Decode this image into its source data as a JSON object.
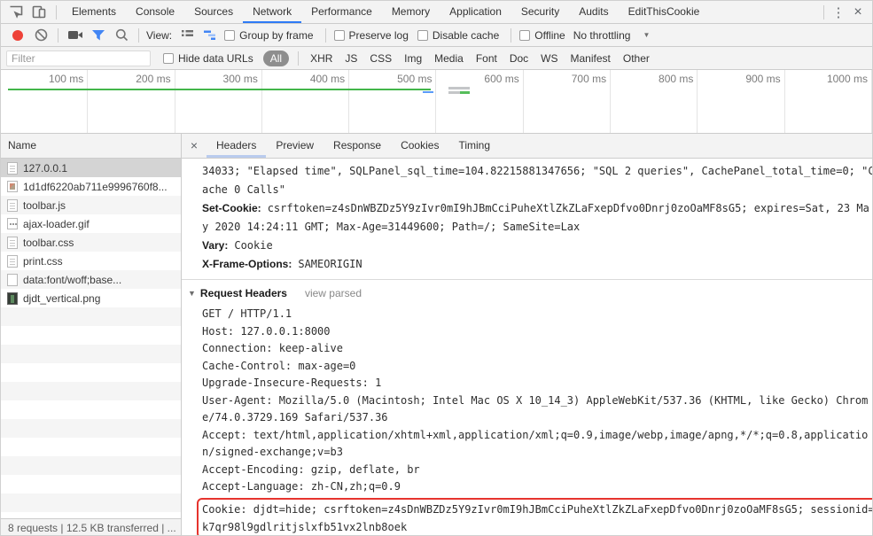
{
  "devtools": {
    "tabs": [
      "Elements",
      "Console",
      "Sources",
      "Network",
      "Performance",
      "Memory",
      "Application",
      "Security",
      "Audits",
      "EditThisCookie"
    ],
    "active_tab": "Network",
    "kebab": "⋮",
    "close": "×"
  },
  "toolbar": {
    "view_label": "View:",
    "checkboxes": [
      "Group by frame",
      "Preserve log",
      "Disable cache",
      "Offline"
    ],
    "throttling": "No throttling"
  },
  "filter_bar": {
    "placeholder": "Filter",
    "hide_label": "Hide data URLs",
    "types": [
      "All",
      "XHR",
      "JS",
      "CSS",
      "Img",
      "Media",
      "Font",
      "Doc",
      "WS",
      "Manifest",
      "Other"
    ],
    "active_type": "All"
  },
  "timeline": {
    "ticks": [
      "100 ms",
      "200 ms",
      "300 ms",
      "400 ms",
      "500 ms",
      "600 ms",
      "700 ms",
      "800 ms",
      "900 ms",
      "1000 ms"
    ]
  },
  "requests": {
    "header": "Name",
    "rows": [
      {
        "name": "127.0.0.1",
        "icon": "document-icon",
        "selected": true
      },
      {
        "name": "1d1df6220ab711e9996760f8...",
        "icon": "image-icon",
        "selected": false
      },
      {
        "name": "toolbar.js",
        "icon": "document-icon",
        "selected": false
      },
      {
        "name": "ajax-loader.gif",
        "icon": "image-dots-icon",
        "selected": false
      },
      {
        "name": "toolbar.css",
        "icon": "document-icon",
        "selected": false
      },
      {
        "name": "print.css",
        "icon": "document-icon",
        "selected": false
      },
      {
        "name": "data:font/woff;base...",
        "icon": "blank-icon",
        "selected": false
      },
      {
        "name": "djdt_vertical.png",
        "icon": "image-dark-icon",
        "selected": false
      }
    ]
  },
  "detail": {
    "close_label": "×",
    "tabs": [
      "Headers",
      "Preview",
      "Response",
      "Cookies",
      "Timing"
    ],
    "active_tab": "Headers"
  },
  "headers_panel": {
    "scrolled_lines": [
      "34033; \"Elapsed time\", SQLPanel_sql_time=104.82215881347656; \"SQL 2 queries\", CachePanel_total_time=0; \"C",
      "ache 0 Calls\""
    ],
    "set_cookie": {
      "name": "Set-Cookie:",
      "value": "csrftoken=z4sDnWBZDz5Y9zIvr0mI9hJBmCciPuheXtlZkZLaFxepDfvo0Dnrj0zoOaMF8sG5; expires=Sat, 23 Ma",
      "wrap": "y 2020 14:24:11 GMT; Max-Age=31449600; Path=/; SameSite=Lax"
    },
    "vary": {
      "name": "Vary:",
      "value": "Cookie"
    },
    "x_frame_options": {
      "name": "X-Frame-Options:",
      "value": "SAMEORIGIN"
    },
    "request_headers": {
      "disclosure": "▼",
      "label": "Request Headers",
      "link": "view parsed",
      "lines": [
        "GET / HTTP/1.1",
        "Host: 127.0.0.1:8000",
        "Connection: keep-alive",
        "Cache-Control: max-age=0",
        "Upgrade-Insecure-Requests: 1",
        "User-Agent: Mozilla/5.0 (Macintosh; Intel Mac OS X 10_14_3) AppleWebKit/537.36 (KHTML, like Gecko) Chrom",
        "e/74.0.3729.169 Safari/537.36",
        "Accept: text/html,application/xhtml+xml,application/xml;q=0.9,image/webp,image/apng,*/*;q=0.8,applicatio",
        "n/signed-exchange;v=b3",
        "Accept-Encoding: gzip, deflate, br",
        "Accept-Language: zh-CN,zh;q=0.9"
      ],
      "cookie_lines": [
        "Cookie: djdt=hide; csrftoken=z4sDnWBZDz5Y9zIvr0mI9hJBmCciPuheXtlZkZLaFxepDfvo0Dnrj0zoOaMF8sG5; sessionid=",
        "k7qr98l9gdlritjslxfb51vx2lnb8oek"
      ]
    }
  },
  "status_bar": {
    "summary": "8 requests | 12.5 KB transferred | ..."
  },
  "colors": {
    "accent_blue": "#2f7bf5",
    "record_red": "#ee4238",
    "filter_blue": "#4285f4",
    "timeline_green": "#43b64a",
    "highlight_red": "#e6342e",
    "selected_row": "#d4d4d4",
    "panel_gray": "#f3f3f3"
  }
}
